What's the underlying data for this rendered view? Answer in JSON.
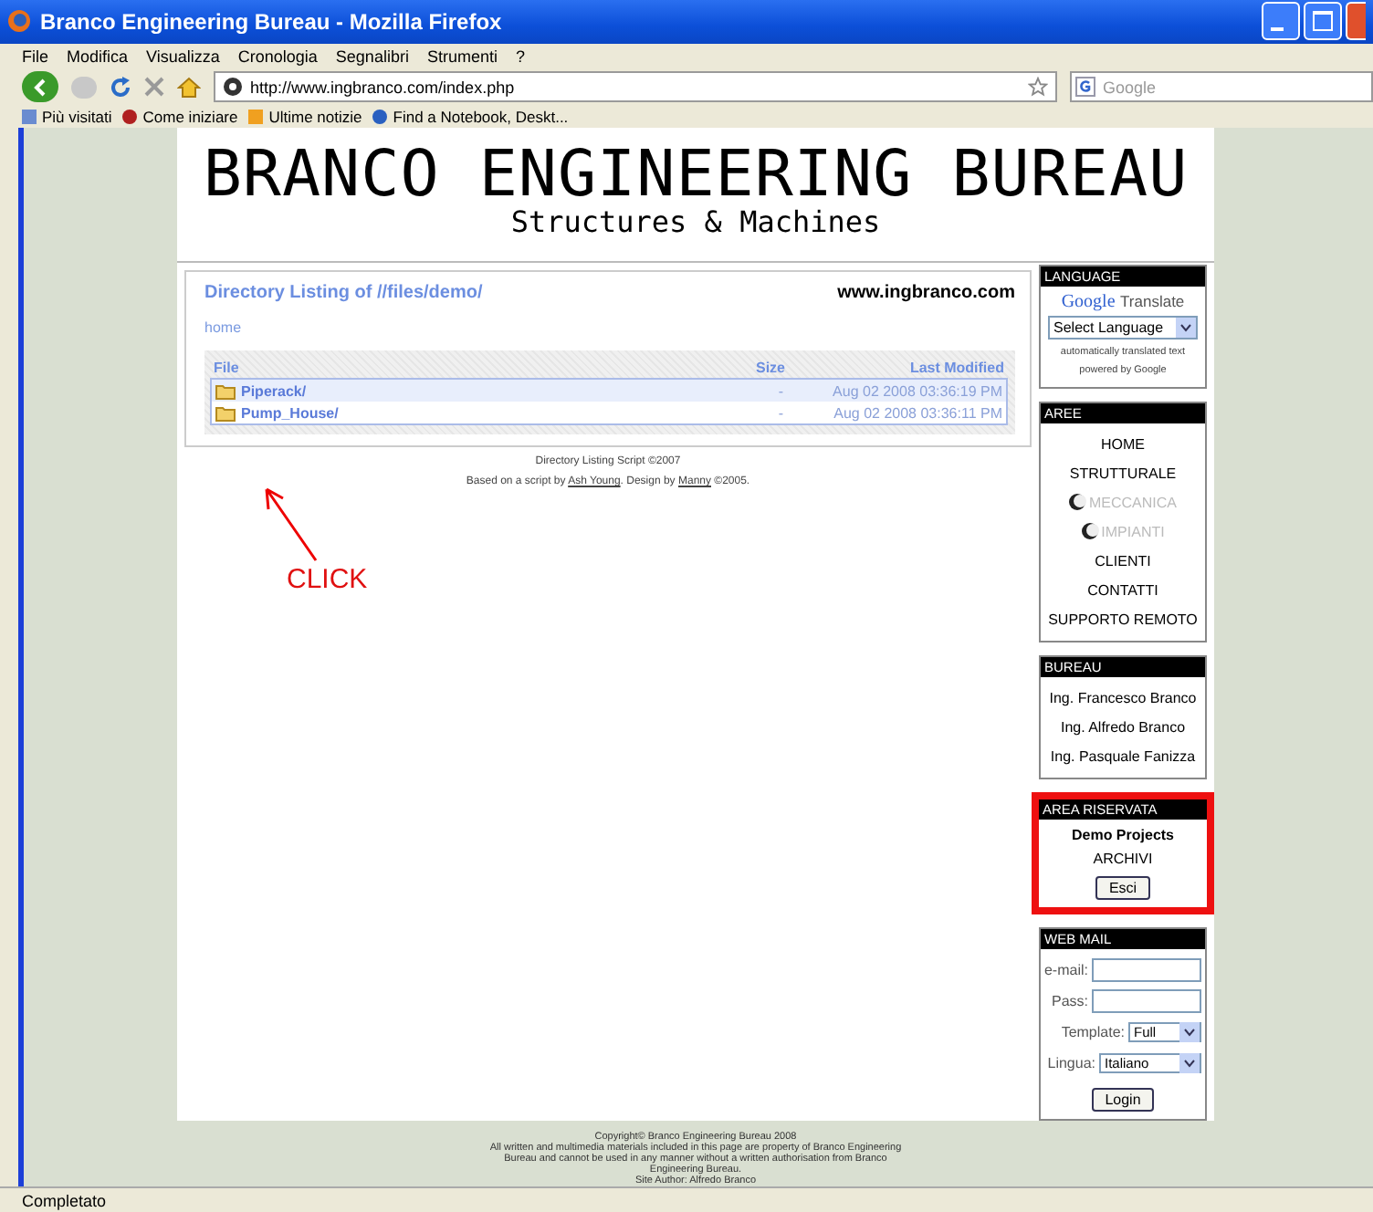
{
  "window": {
    "title": "Branco Engineering Bureau - Mozilla Firefox"
  },
  "menu": [
    "File",
    "Modifica",
    "Visualizza",
    "Cronologia",
    "Segnalibri",
    "Strumenti",
    "?"
  ],
  "nav": {
    "url": "http://www.ingbranco.com/index.php",
    "search_placeholder": "Google"
  },
  "bookmarks": [
    "Più visitati",
    "Come iniziare",
    "Ultime notizie",
    "Find a Notebook, Deskt..."
  ],
  "site": {
    "title": "BRANCO ENGINEERING BUREAU",
    "subtitle": "Structures & Machines"
  },
  "listing": {
    "title": "Directory Listing of //files/demo/",
    "domain": "www.ingbranco.com",
    "home_link": "home",
    "columns": [
      "File",
      "Size",
      "Last Modified"
    ],
    "rows": [
      {
        "name": "Piperack/",
        "size": "-",
        "modified": "Aug 02 2008 03:36:19 PM",
        "selected": true
      },
      {
        "name": "Pump_House/",
        "size": "-",
        "modified": "Aug 02 2008 03:36:11 PM",
        "selected": false
      }
    ],
    "credit": "Directory Listing Script ©2007",
    "credit2": {
      "before": "Based on a script by",
      "author": "Ash Young",
      "middle": ". Design by",
      "designer": "Manny",
      "after": "©2005."
    }
  },
  "annotation": {
    "label": "CLICK"
  },
  "sidebar": [
    {
      "kind": "language",
      "heading": "LANGUAGE",
      "brand": "Google",
      "product": "Translate",
      "select": "Select Language",
      "note": "automatically translated text",
      "note2": "powered by Google",
      "highlighted": false
    },
    {
      "kind": "links",
      "heading": "AREE",
      "highlighted": false,
      "items": [
        {
          "label": "HOME",
          "disabled": false
        },
        {
          "label": "STRUTTURALE",
          "disabled": false
        },
        {
          "label": "MECCANICA",
          "disabled": true
        },
        {
          "label": "IMPIANTI",
          "disabled": true
        },
        {
          "label": "CLIENTI",
          "disabled": false
        },
        {
          "label": "CONTATTI",
          "disabled": false
        },
        {
          "label": "SUPPORTO REMOTO",
          "disabled": false
        }
      ]
    },
    {
      "kind": "links",
      "heading": "BUREAU",
      "highlighted": false,
      "items": [
        {
          "label": "Ing. Francesco Branco",
          "disabled": false
        },
        {
          "label": "Ing. Alfredo Branco",
          "disabled": false
        },
        {
          "label": "Ing. Pasquale Fanizza",
          "disabled": false
        }
      ]
    },
    {
      "kind": "reserved",
      "heading": "AREA RISERVATA",
      "highlighted": true,
      "title": "Demo Projects",
      "link": "ARCHIVI",
      "button": "Esci"
    },
    {
      "kind": "webmail",
      "heading": "WEB MAIL",
      "highlighted": false,
      "email_label": "e-mail:",
      "pass_label": "Pass:",
      "template_label": "Template:",
      "template": "Full",
      "lang_label": "Lingua:",
      "lang": "Italiano",
      "button": "Login"
    }
  ],
  "footer": [
    "Copyright© Branco Engineering Bureau 2008",
    "All written and multimedia materials included in this page are property of Branco Engineering",
    "Bureau and cannot be used in any manner without a written authorisation from Branco",
    "Engineering Bureau.",
    "Site Author: Alfredo Branco"
  ],
  "status_bar": "Completato"
}
